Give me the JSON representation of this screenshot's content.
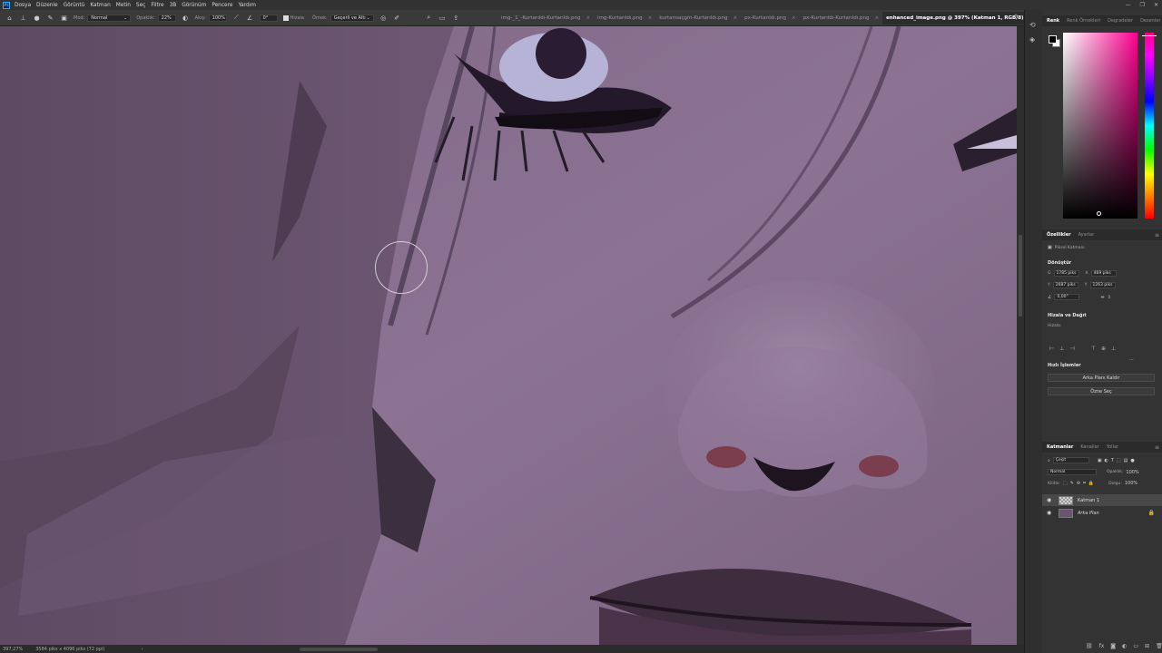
{
  "app": {
    "logo": "Ps",
    "menu": [
      "Dosya",
      "Düzenle",
      "Görüntü",
      "Katman",
      "Metin",
      "Seç",
      "Filtre",
      "3B",
      "Görünüm",
      "Pencere",
      "Yardım"
    ],
    "window_controls": [
      "—",
      "❐",
      "✕"
    ]
  },
  "options_bar": {
    "mode_label": "Mod:",
    "mode_value": "Normal",
    "opacity_label": "Opaklık:",
    "opacity_value": "22%",
    "flow_label": "Akış:",
    "flow_value": "100%",
    "angle_value": "0°",
    "smoothing_label": "Hizala",
    "sample_label": "Örnek:",
    "sample_value": "Geçerli ve Altı"
  },
  "tabs": [
    {
      "label": "img-_1_-Kurtarıldı-Kurtarıldı.png",
      "active": false
    },
    {
      "label": "img-Kurtarıldı.png",
      "active": false
    },
    {
      "label": "kurtarısaçgm-Kurtarıldı.png",
      "active": false
    },
    {
      "label": "px-Kurtarıldı.png",
      "active": false
    },
    {
      "label": "px-Kurtarıldı-Kurtarıldı.png",
      "active": false
    },
    {
      "label": "enhanced_image.png @ 397% (Katman 1, RGB/8) *",
      "active": true
    }
  ],
  "status": {
    "zoom": "397,27%",
    "doc_info": "3584 piks x 4096 piks (72 ppi)",
    "arrow": "›"
  },
  "color_panel": {
    "tabs": [
      "Renk",
      "Renk Örnekleri",
      "Degradeler",
      "Desenler"
    ],
    "foreground": "#000000",
    "background": "#ffffff"
  },
  "properties": {
    "tabs": [
      "Özellikler",
      "Ayarlar"
    ],
    "layer_type": "Piksel Katmanı",
    "transform_title": "Dönüştür",
    "w_label": "G",
    "w_value": "1785 piks",
    "x_label": "X",
    "x_value": "469 piks",
    "h_label": "Y",
    "h_value": "2687 piks",
    "y_label": "Y",
    "y_value": "1263 piks",
    "angle_value": "0,00°",
    "align_title": "Hizala ve Dağıt",
    "align_sub": "Hizala:",
    "quick_title": "Hızlı İşlemler",
    "remove_bg": "Arka Planı Kaldır",
    "select_subject": "Özne Seç"
  },
  "layers": {
    "tabs": [
      "Katmanlar",
      "Kanallar",
      "Yollar"
    ],
    "filter_label": "Çeşit",
    "blend_mode": "Normal",
    "opacity_label": "Opaklık:",
    "opacity_value": "100%",
    "lock_label": "Kilitle:",
    "fill_label": "Dolgu:",
    "fill_value": "100%",
    "items": [
      {
        "name": "Katman 1",
        "selected": true
      },
      {
        "name": "Arka Plan",
        "selected": false
      }
    ]
  }
}
